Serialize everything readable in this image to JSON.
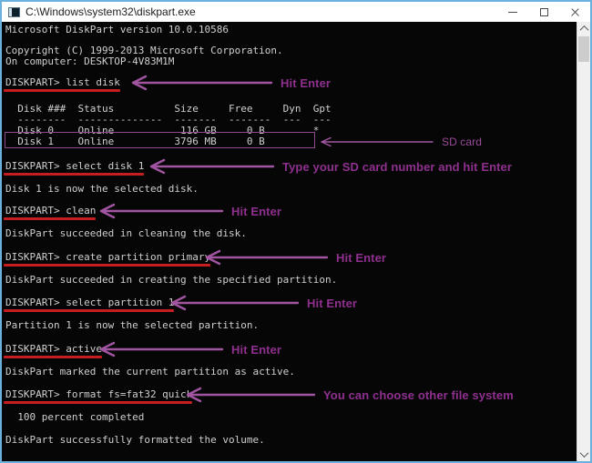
{
  "window": {
    "title": "C:\\Windows\\system32\\diskpart.exe",
    "icons": {
      "app_icon": "console-window-icon",
      "minimize": "minimize-icon",
      "maximize": "maximize-icon",
      "close": "close-icon",
      "scroll_up": "chevron-up-icon",
      "scroll_down": "chevron-down-icon"
    }
  },
  "colors": {
    "window_border": "#6ab1dd",
    "console_bg": "#060606",
    "console_text": "#cfcfcf",
    "annotation_text": "#8f308f",
    "annotation_arrow": "#a155a1",
    "command_underline": "#c41e1e"
  },
  "console": {
    "lines": [
      {
        "type": "output",
        "text": "Microsoft DiskPart version 10.0.10586"
      },
      {
        "type": "output",
        "text": "Copyright (C) 1999-2013 Microsoft Corporation."
      },
      {
        "type": "output",
        "text": "On computer: DESKTOP-4V83M1M"
      },
      {
        "type": "command",
        "text": "DISKPART> list disk"
      },
      {
        "type": "table",
        "text": "  Disk ###  Status          Size     Free     Dyn  Gpt"
      },
      {
        "type": "table",
        "text": "  --------  --------------  -------  -------  ---  ---"
      },
      {
        "type": "table",
        "text": "  Disk 0    Online           116 GB     0 B        *"
      },
      {
        "type": "table",
        "text": "  Disk 1    Online          3796 MB     0 B"
      },
      {
        "type": "command",
        "text": "DISKPART> select disk 1"
      },
      {
        "type": "output",
        "text": "Disk 1 is now the selected disk."
      },
      {
        "type": "command",
        "text": "DISKPART> clean"
      },
      {
        "type": "output",
        "text": "DiskPart succeeded in cleaning the disk."
      },
      {
        "type": "command",
        "text": "DISKPART> create partition primary"
      },
      {
        "type": "output",
        "text": "DiskPart succeeded in creating the specified partition."
      },
      {
        "type": "command",
        "text": "DISKPART> select partition 1"
      },
      {
        "type": "output",
        "text": "Partition 1 is now the selected partition."
      },
      {
        "type": "command",
        "text": "DISKPART> active"
      },
      {
        "type": "output",
        "text": "DiskPart marked the current partition as active."
      },
      {
        "type": "command",
        "text": "DISKPART> format fs=fat32 quick"
      },
      {
        "type": "output",
        "text": "  100 percent completed"
      },
      {
        "type": "output",
        "text": "DiskPart successfully formatted the volume."
      }
    ]
  },
  "annotations": [
    {
      "label": "Hit Enter"
    },
    {
      "label": "SD card"
    },
    {
      "label": "Type your SD card number and hit Enter"
    },
    {
      "label": "Hit Enter"
    },
    {
      "label": "Hit Enter"
    },
    {
      "label": "Hit Enter"
    },
    {
      "label": "Hit Enter"
    },
    {
      "label": "You can choose other file system"
    }
  ]
}
